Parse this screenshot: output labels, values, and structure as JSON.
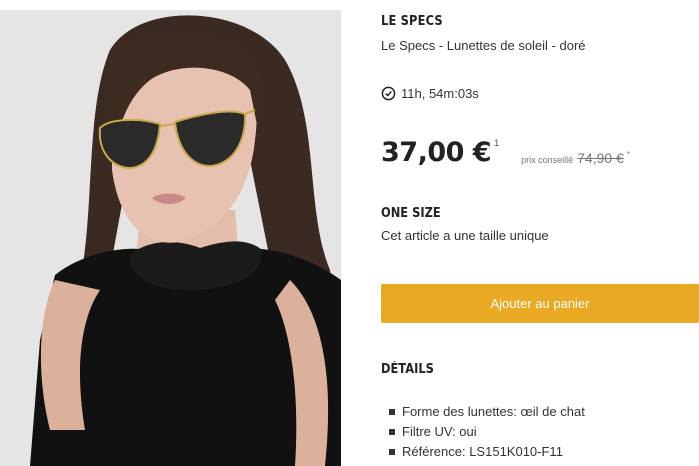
{
  "product": {
    "brand": "LE SPECS",
    "title": "Le Specs - Lunettes de soleil - doré",
    "timer": "11h, 54m:03s",
    "price": "37,00 €",
    "price_note_marker": "1",
    "rrp_label": "prix conseillé",
    "rrp_price": "74,90 €",
    "rrp_marker": "*",
    "image_icon": "woman-with-sunglasses-photo"
  },
  "size": {
    "title": "ONE SIZE",
    "description": "Cet article a une taille unique"
  },
  "cart": {
    "button_label": "Ajouter au panier",
    "button_color": "#e9a922"
  },
  "details": {
    "title": "DÉTAILS",
    "items": [
      "Forme des lunettes: œil de chat",
      "Filtre UV: oui",
      "Référence: LS151K010-F11"
    ]
  }
}
